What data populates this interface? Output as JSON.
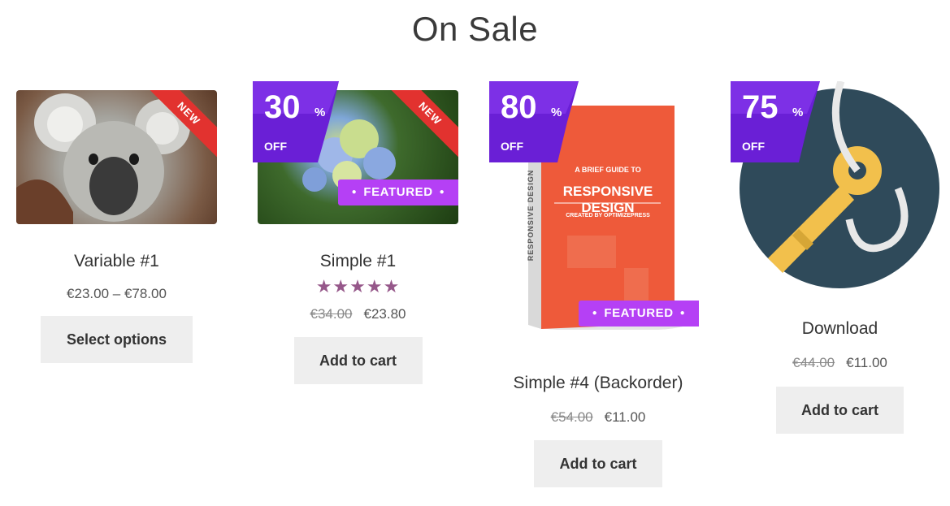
{
  "section": {
    "title": "On Sale"
  },
  "products": [
    {
      "name": "Variable #1",
      "price_range": "€23.00 – €78.00",
      "button": "Select options",
      "ribbon": "NEW"
    },
    {
      "name": "Simple #1",
      "rating": 5,
      "stars": "★★★★★",
      "old_price": "€34.00",
      "price": "€23.80",
      "button": "Add to cart",
      "ribbon": "NEW",
      "sale_percent": "30",
      "sale_symbol": "%",
      "sale_off": "OFF",
      "featured": "FEATURED"
    },
    {
      "name": "Simple #4 (Backorder)",
      "old_price": "€54.00",
      "price": "€11.00",
      "button": "Add to cart",
      "sale_percent": "80",
      "sale_symbol": "%",
      "sale_off": "OFF",
      "featured": "FEATURED",
      "book": {
        "subtitle": "A BRIEF GUIDE TO",
        "title": "RESPONSIVE DESIGN",
        "credit": "CREATED BY OPTIMIZEPRESS",
        "spine": "RESPONSIVE DESIGN"
      }
    },
    {
      "name": "Download",
      "old_price": "€44.00",
      "price": "€11.00",
      "button": "Add to cart",
      "sale_percent": "75",
      "sale_symbol": "%",
      "sale_off": "OFF"
    }
  ],
  "colors": {
    "ribbon_red": "#e2322f",
    "sale_purple": "#6a1fd6",
    "featured_purple": "#b540f5",
    "star_color": "#96588a",
    "button_bg": "#eeeeee"
  }
}
